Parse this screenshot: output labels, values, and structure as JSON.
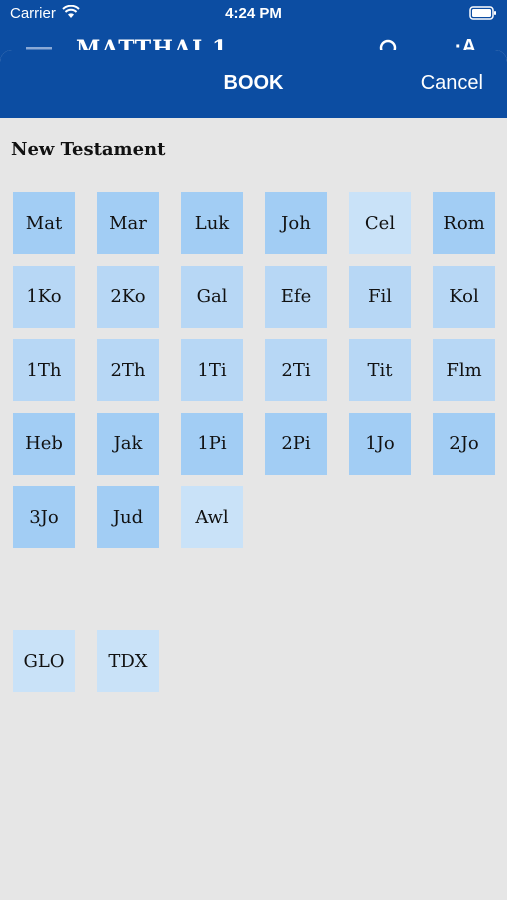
{
  "status_bar": {
    "carrier": "Carrier",
    "time": "4:24 PM"
  },
  "background_header": {
    "title": "MATTHAI  1"
  },
  "sheet": {
    "title": "BOOK",
    "cancel_label": "Cancel",
    "section_title": "New Testament"
  },
  "books": [
    {
      "label": "Mat",
      "shade": "mid"
    },
    {
      "label": "Mar",
      "shade": "mid"
    },
    {
      "label": "Luk",
      "shade": "mid"
    },
    {
      "label": "Joh",
      "shade": "mid"
    },
    {
      "label": "Cel",
      "shade": "pale"
    },
    {
      "label": "Rom",
      "shade": "mid"
    },
    {
      "label": "1Ko",
      "shade": "light"
    },
    {
      "label": "2Ko",
      "shade": "light"
    },
    {
      "label": "Gal",
      "shade": "light"
    },
    {
      "label": "Efe",
      "shade": "light"
    },
    {
      "label": "Fil",
      "shade": "light"
    },
    {
      "label": "Kol",
      "shade": "light"
    },
    {
      "label": "1Th",
      "shade": "light"
    },
    {
      "label": "2Th",
      "shade": "light"
    },
    {
      "label": "1Ti",
      "shade": "light"
    },
    {
      "label": "2Ti",
      "shade": "light"
    },
    {
      "label": "Tit",
      "shade": "light"
    },
    {
      "label": "Flm",
      "shade": "light"
    },
    {
      "label": "Heb",
      "shade": "mid"
    },
    {
      "label": "Jak",
      "shade": "mid"
    },
    {
      "label": "1Pi",
      "shade": "mid"
    },
    {
      "label": "2Pi",
      "shade": "mid"
    },
    {
      "label": "1Jo",
      "shade": "mid"
    },
    {
      "label": "2Jo",
      "shade": "mid"
    },
    {
      "label": "3Jo",
      "shade": "mid"
    },
    {
      "label": "Jud",
      "shade": "mid"
    },
    {
      "label": "Awl",
      "shade": "pale"
    }
  ],
  "extras": [
    {
      "label": "GLO",
      "shade": "pale"
    },
    {
      "label": "TDX",
      "shade": "pale"
    }
  ],
  "colors": {
    "primary": "#0c4da2",
    "tile_mid": "#a2cdf4",
    "tile_light": "#b7d7f5",
    "tile_pale": "#c9e2f8",
    "background": "#e6e6e6"
  }
}
